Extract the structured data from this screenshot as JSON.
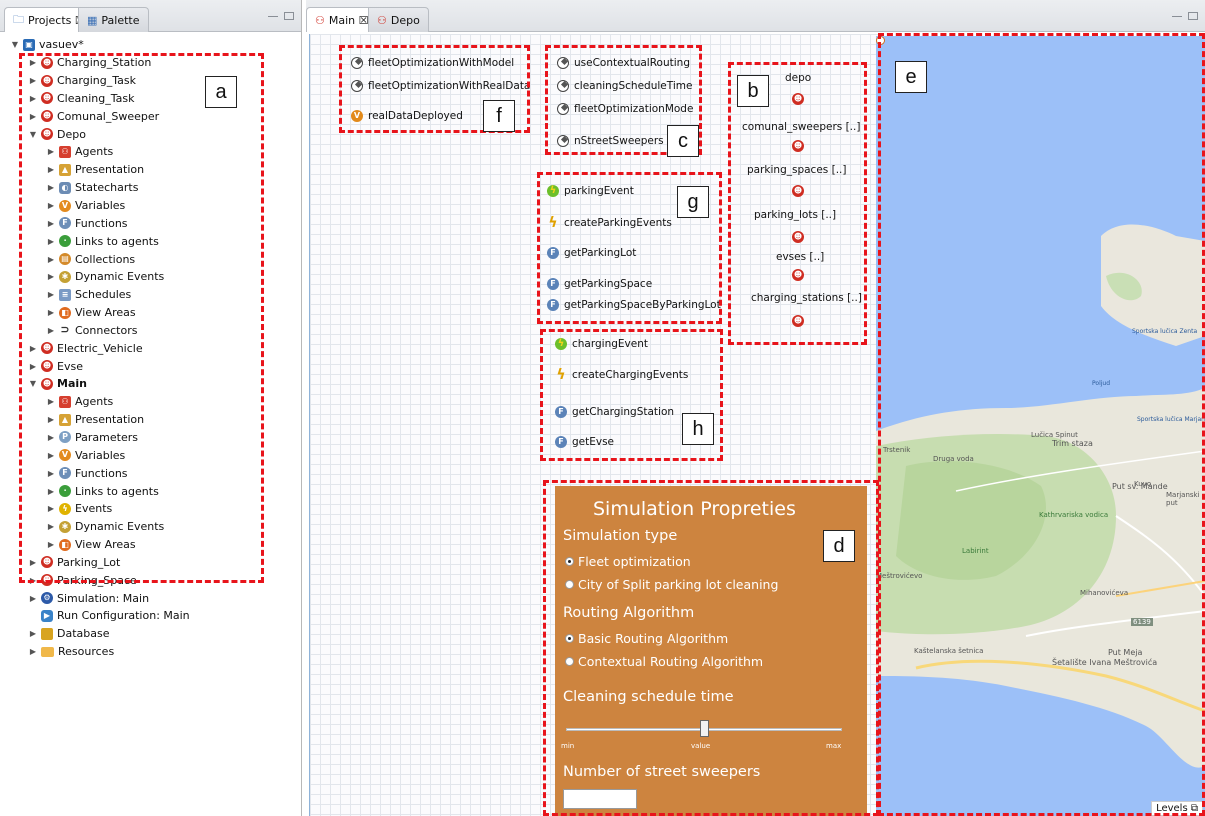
{
  "left_panel": {
    "tabs": [
      {
        "label": "Projects ☒"
      },
      {
        "label": "Palette"
      }
    ],
    "tree": [
      {
        "label": "vasuev*",
        "indent": 0,
        "arrow": "▼",
        "icon": "model"
      },
      {
        "label": "Charging_Station",
        "indent": 1,
        "arrow": "▶",
        "icon": "agent"
      },
      {
        "label": "Charging_Task",
        "indent": 1,
        "arrow": "▶",
        "icon": "agent"
      },
      {
        "label": "Cleaning_Task",
        "indent": 1,
        "arrow": "▶",
        "icon": "agent"
      },
      {
        "label": "Comunal_Sweeper",
        "indent": 1,
        "arrow": "▶",
        "icon": "agent"
      },
      {
        "label": "Depo",
        "indent": 1,
        "arrow": "▼",
        "icon": "agent"
      },
      {
        "label": "Agents",
        "indent": 2,
        "arrow": "▶",
        "icon": "multi"
      },
      {
        "label": "Presentation",
        "indent": 2,
        "arrow": "▶",
        "icon": "pres"
      },
      {
        "label": "Statecharts",
        "indent": 2,
        "arrow": "▶",
        "icon": "state"
      },
      {
        "label": "Variables",
        "indent": 2,
        "arrow": "▶",
        "icon": "var"
      },
      {
        "label": "Functions",
        "indent": 2,
        "arrow": "▶",
        "icon": "func"
      },
      {
        "label": "Links to agents",
        "indent": 2,
        "arrow": "▶",
        "icon": "links"
      },
      {
        "label": "Collections",
        "indent": 2,
        "arrow": "▶",
        "icon": "coll"
      },
      {
        "label": "Dynamic Events",
        "indent": 2,
        "arrow": "▶",
        "icon": "dyn"
      },
      {
        "label": "Schedules",
        "indent": 2,
        "arrow": "▶",
        "icon": "sched"
      },
      {
        "label": "View Areas",
        "indent": 2,
        "arrow": "▶",
        "icon": "view"
      },
      {
        "label": "Connectors",
        "indent": 2,
        "arrow": "▶",
        "icon": "conn"
      },
      {
        "label": "Electric_Vehicle",
        "indent": 1,
        "arrow": "▶",
        "icon": "agent"
      },
      {
        "label": "Evse",
        "indent": 1,
        "arrow": "▶",
        "icon": "agent"
      },
      {
        "label": "Main",
        "indent": 1,
        "arrow": "▼",
        "icon": "agent",
        "bold": true
      },
      {
        "label": "Agents",
        "indent": 2,
        "arrow": "▶",
        "icon": "multi"
      },
      {
        "label": "Presentation",
        "indent": 2,
        "arrow": "▶",
        "icon": "pres"
      },
      {
        "label": "Parameters",
        "indent": 2,
        "arrow": "▶",
        "icon": "param"
      },
      {
        "label": "Variables",
        "indent": 2,
        "arrow": "▶",
        "icon": "var"
      },
      {
        "label": "Functions",
        "indent": 2,
        "arrow": "▶",
        "icon": "func"
      },
      {
        "label": "Links to agents",
        "indent": 2,
        "arrow": "▶",
        "icon": "links"
      },
      {
        "label": "Events",
        "indent": 2,
        "arrow": "▶",
        "icon": "evt"
      },
      {
        "label": "Dynamic Events",
        "indent": 2,
        "arrow": "▶",
        "icon": "dyn"
      },
      {
        "label": "View Areas",
        "indent": 2,
        "arrow": "▶",
        "icon": "view"
      },
      {
        "label": "Parking_Lot",
        "indent": 1,
        "arrow": "▶",
        "icon": "agent"
      },
      {
        "label": "Parking_Space",
        "indent": 1,
        "arrow": "▶",
        "icon": "agent"
      },
      {
        "label": "Simulation: Main",
        "indent": 1,
        "arrow": "▶",
        "icon": "sim"
      },
      {
        "label": "Run Configuration: Main",
        "indent": 1,
        "arrow": "",
        "icon": "run"
      },
      {
        "label": "Database",
        "indent": 1,
        "arrow": "▶",
        "icon": "db"
      },
      {
        "label": "Resources",
        "indent": 1,
        "arrow": "▶",
        "icon": "folder"
      }
    ]
  },
  "editor": {
    "tabs": [
      {
        "label": "Main ☒"
      },
      {
        "label": "Depo"
      }
    ],
    "group_f": [
      "fleetOptimizationWithModel",
      "fleetOptimizationWithRealData",
      "realDataDeployed"
    ],
    "group_c": [
      "useContextualRouting",
      "cleaningScheduleTime",
      "fleetOptimizationMode",
      "nStreetSweepers"
    ],
    "group_b": [
      "depo",
      "comunal_sweepers [..]",
      "parking_spaces [..]",
      "parking_lots [..]",
      "evses [..]",
      "charging_stations [..]"
    ],
    "group_g": [
      "parkingEvent",
      "createParkingEvents",
      "getParkingLot",
      "getParkingSpace",
      "getParkingSpaceByParkingLot"
    ],
    "group_h": [
      "chargingEvent",
      "createChargingEvents",
      "getChargingStation",
      "getEvse"
    ],
    "labels": {
      "a": "a",
      "b": "b",
      "c": "c",
      "d": "d",
      "e": "e",
      "f": "f",
      "g": "g",
      "h": "h"
    }
  },
  "sim_properties": {
    "title": "Simulation Propreties",
    "simulation_type_label": "Simulation type",
    "simulation_types": [
      "Fleet optimization",
      "City of Split parking lot cleaning"
    ],
    "simulation_type_selected": 0,
    "routing_label": "Routing Algorithm",
    "routing_options": [
      "Basic Routing Algorithm",
      "Contextual Routing Algorithm"
    ],
    "routing_selected": 0,
    "cleaning_label": "Cleaning schedule time",
    "slider": {
      "min": "min",
      "value": "value",
      "max": "max",
      "position": 0.5
    },
    "sweepers_label": "Number of street sweepers",
    "sweepers_value": ""
  },
  "map": {
    "levels_label": "Levels",
    "place_labels": [
      "Trstenik",
      "Trim staza",
      "Put sv. Mande",
      "Kathrvariska vodica",
      "Druga voda",
      "Lučica Spinut",
      "Meštrovićevo",
      "Mihanovićeva",
      "Šetalište Ivana Meštrovića",
      "Put Meja",
      "Sportska lučica Zenta",
      "Poljud",
      "Sportska lučica Marjan",
      "Marjanski put",
      "Kaštelanska šetnica",
      "Labirint",
      "Kuvo",
      "6139"
    ]
  }
}
